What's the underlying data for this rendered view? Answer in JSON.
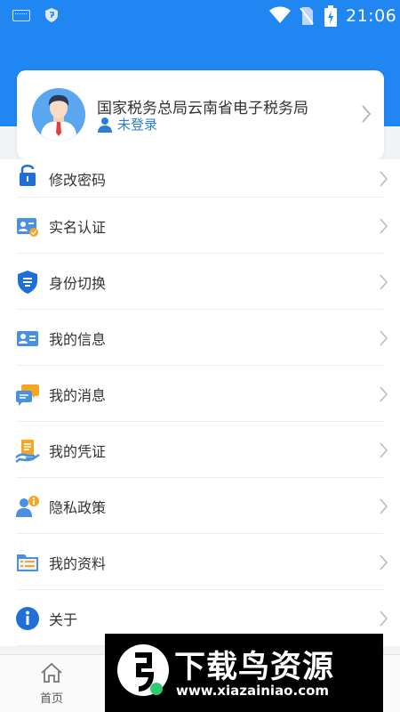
{
  "status_bar": {
    "time": "21:06",
    "icons": [
      "keyboard-icon",
      "shield-icon",
      "wifi-icon",
      "no-sim-icon",
      "battery-charging-icon"
    ]
  },
  "profile": {
    "org_name": "国家税务总局云南省电子税务局",
    "login_status": "未登录"
  },
  "menu": {
    "items": [
      {
        "label": "修改密码",
        "icon": "lock-icon"
      },
      {
        "label": "实名认证",
        "icon": "id-verify-icon"
      },
      {
        "label": "身份切换",
        "icon": "shield-authorize-icon"
      },
      {
        "label": "我的信息",
        "icon": "id-card-icon"
      },
      {
        "label": "我的消息",
        "icon": "chat-bubbles-icon"
      },
      {
        "label": "我的凭证",
        "icon": "receipt-hand-icon"
      },
      {
        "label": "隐私政策",
        "icon": "user-info-icon"
      },
      {
        "label": "我的资料",
        "icon": "folder-list-icon"
      },
      {
        "label": "关于",
        "icon": "info-icon"
      }
    ]
  },
  "tabbar": {
    "home_label": "首页"
  },
  "watermark": {
    "title": "下载鸟资源",
    "url": "www.xiazainiao.com"
  },
  "colors": {
    "brand_blue": "#1f86f2",
    "link_blue": "#2a7fd4",
    "background": "#f2f3f5"
  }
}
